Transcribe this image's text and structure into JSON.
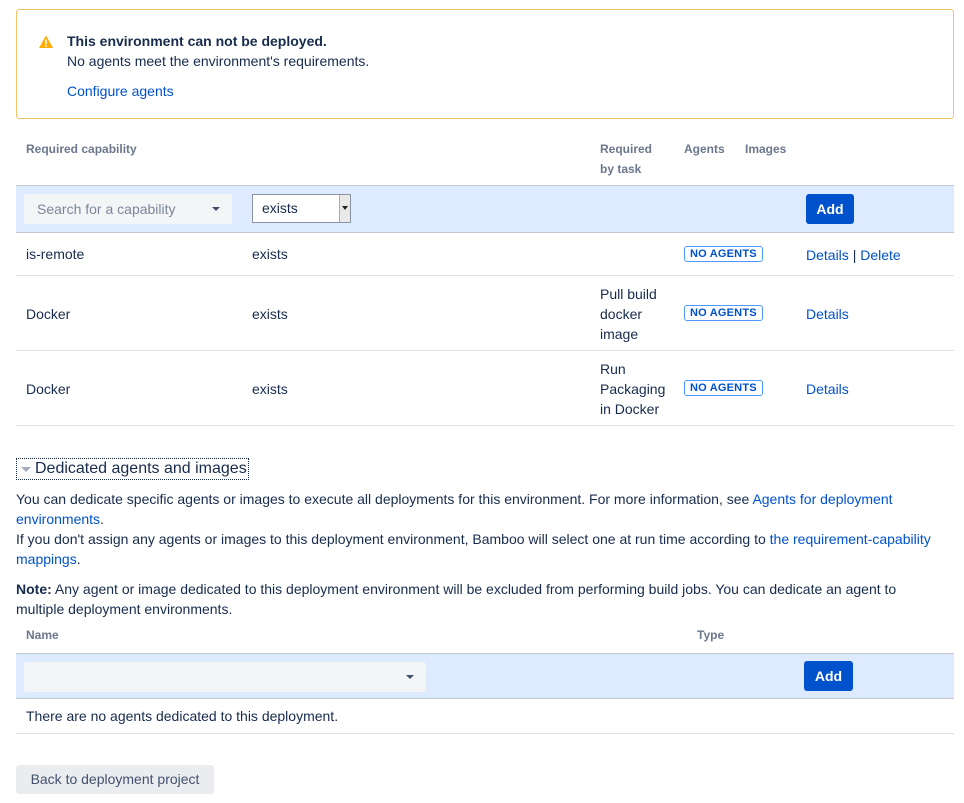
{
  "warning": {
    "title": "This environment can not be deployed.",
    "body": "No agents meet the environment's requirements.",
    "link": "Configure agents",
    "color": "#f0c36d"
  },
  "requirements": {
    "headers": {
      "capability": "Required capability",
      "required_by_task_line1": "Required",
      "required_by_task_line2": "by task",
      "agents": "Agents",
      "images": "Images"
    },
    "add_row": {
      "search_placeholder": "Search for a capability",
      "operator_value": "exists",
      "add_label": "Add"
    },
    "rows": [
      {
        "capability": "is-remote",
        "condition": "exists",
        "task_lines": [],
        "agents_badge": "NO AGENTS",
        "actions": [
          "Details",
          "Delete"
        ]
      },
      {
        "capability": "Docker",
        "condition": "exists",
        "task_lines": [
          "Pull build",
          "docker",
          "image"
        ],
        "agents_badge": "NO AGENTS",
        "actions": [
          "Details"
        ]
      },
      {
        "capability": "Docker",
        "condition": "exists",
        "task_lines": [
          "Run",
          "Packaging",
          "in Docker"
        ],
        "agents_badge": "NO AGENTS",
        "actions": [
          "Details"
        ]
      }
    ],
    "action_separator": "|"
  },
  "dedicated": {
    "heading": "Dedicated agents and images",
    "para1_text": "You can dedicate specific agents or images to execute all deployments for this environment. For more information, see ",
    "para1_link": "Agents for deployment environments",
    "para1_end": ".",
    "para2_text": "If you don't assign any agents or images to this deployment environment, Bamboo will select one at run time according to ",
    "para2_link": "the requirement-capability mappings",
    "para2_end": ".",
    "note_label": "Note:",
    "note_text": " Any agent or image dedicated to this deployment environment will be excluded from performing build jobs. You can dedicate an agent to multiple deployment environments.",
    "headers": {
      "name": "Name",
      "type": "Type"
    },
    "add_label": "Add",
    "empty_text": "There are no agents dedicated to this deployment."
  },
  "back_button": "Back to deployment project",
  "colors": {
    "primary": "#0052cc",
    "add_row_bg": "#deebff",
    "text": "#172b4d",
    "muted": "#6b778c"
  }
}
